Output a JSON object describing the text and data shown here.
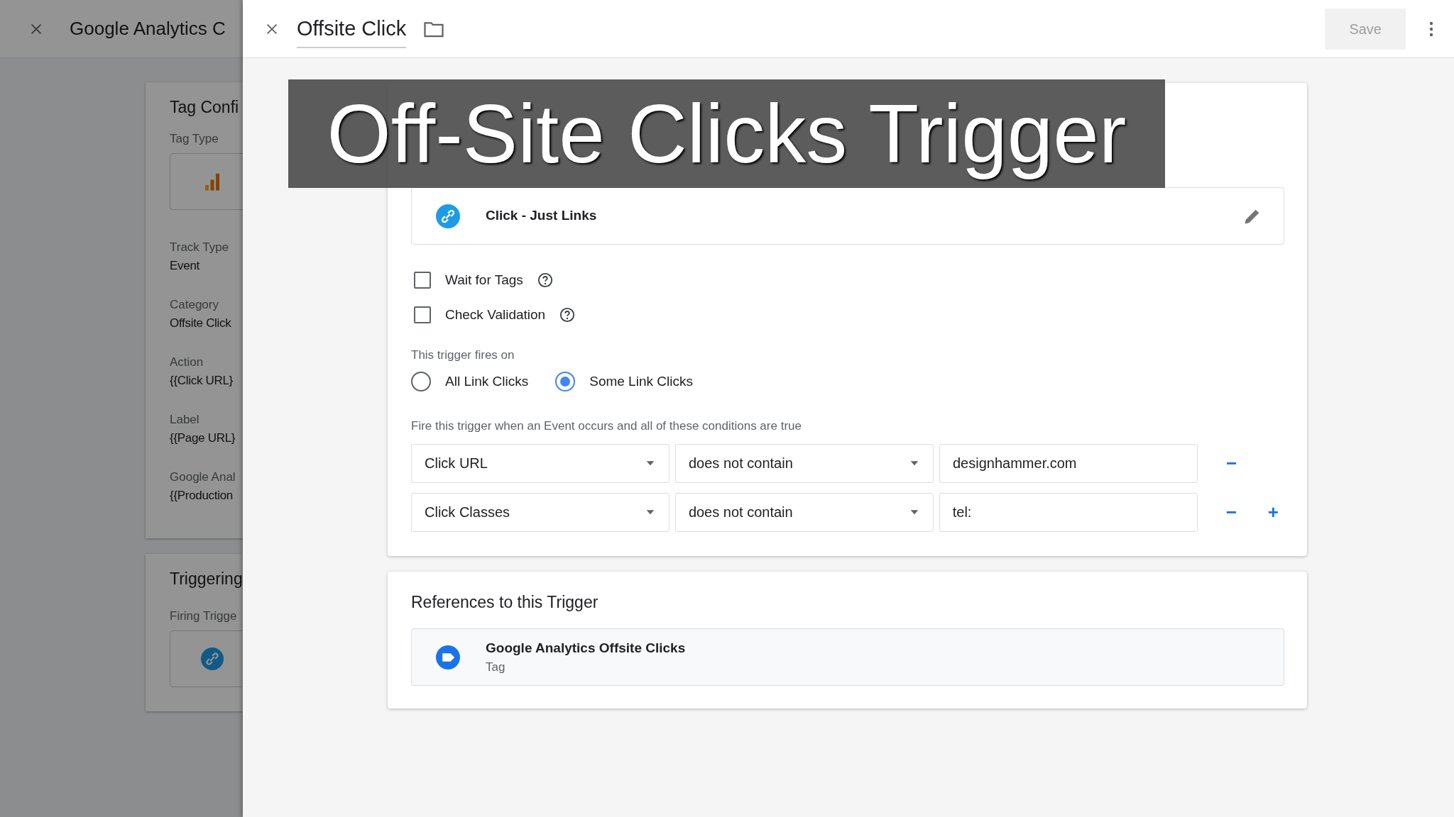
{
  "caption": "Off-Site Clicks Trigger",
  "background_tag": {
    "title": "Google Analytics C",
    "config_title": "Tag Confi",
    "tag_type_label": "Tag Type",
    "fields": [
      {
        "label": "Track Type",
        "value": "Event"
      },
      {
        "label": "Category",
        "value": "Offsite Click"
      },
      {
        "label": "Action",
        "value": "{{Click URL}"
      },
      {
        "label": "Label",
        "value": "{{Page URL}"
      },
      {
        "label": "Google Anal",
        "value": "{{Production"
      }
    ],
    "triggering_title": "Triggering",
    "firing_label": "Firing Trigge"
  },
  "editor": {
    "title": "Offsite Click",
    "save": "Save",
    "save_disabled": true
  },
  "trigger": {
    "type": "Click - Just Links",
    "options": [
      {
        "label": "Wait for Tags",
        "checked": false
      },
      {
        "label": "Check Validation",
        "checked": false
      }
    ],
    "fires_on_label": "This trigger fires on",
    "fires_on": [
      {
        "label": "All Link Clicks",
        "selected": false
      },
      {
        "label": "Some Link Clicks",
        "selected": true
      }
    ],
    "conditions_label": "Fire this trigger when an Event occurs and all of these conditions are true",
    "conditions": [
      {
        "variable": "Click URL",
        "operator": "does not contain",
        "value": "designhammer.com",
        "actions": [
          "−"
        ]
      },
      {
        "variable": "Click Classes",
        "operator": "does not contain",
        "value": "tel:",
        "actions": [
          "−",
          "+"
        ]
      }
    ]
  },
  "references": {
    "title": "References to this Trigger",
    "items": [
      {
        "name": "Google Analytics Offsite Clicks",
        "type": "Tag"
      }
    ]
  }
}
